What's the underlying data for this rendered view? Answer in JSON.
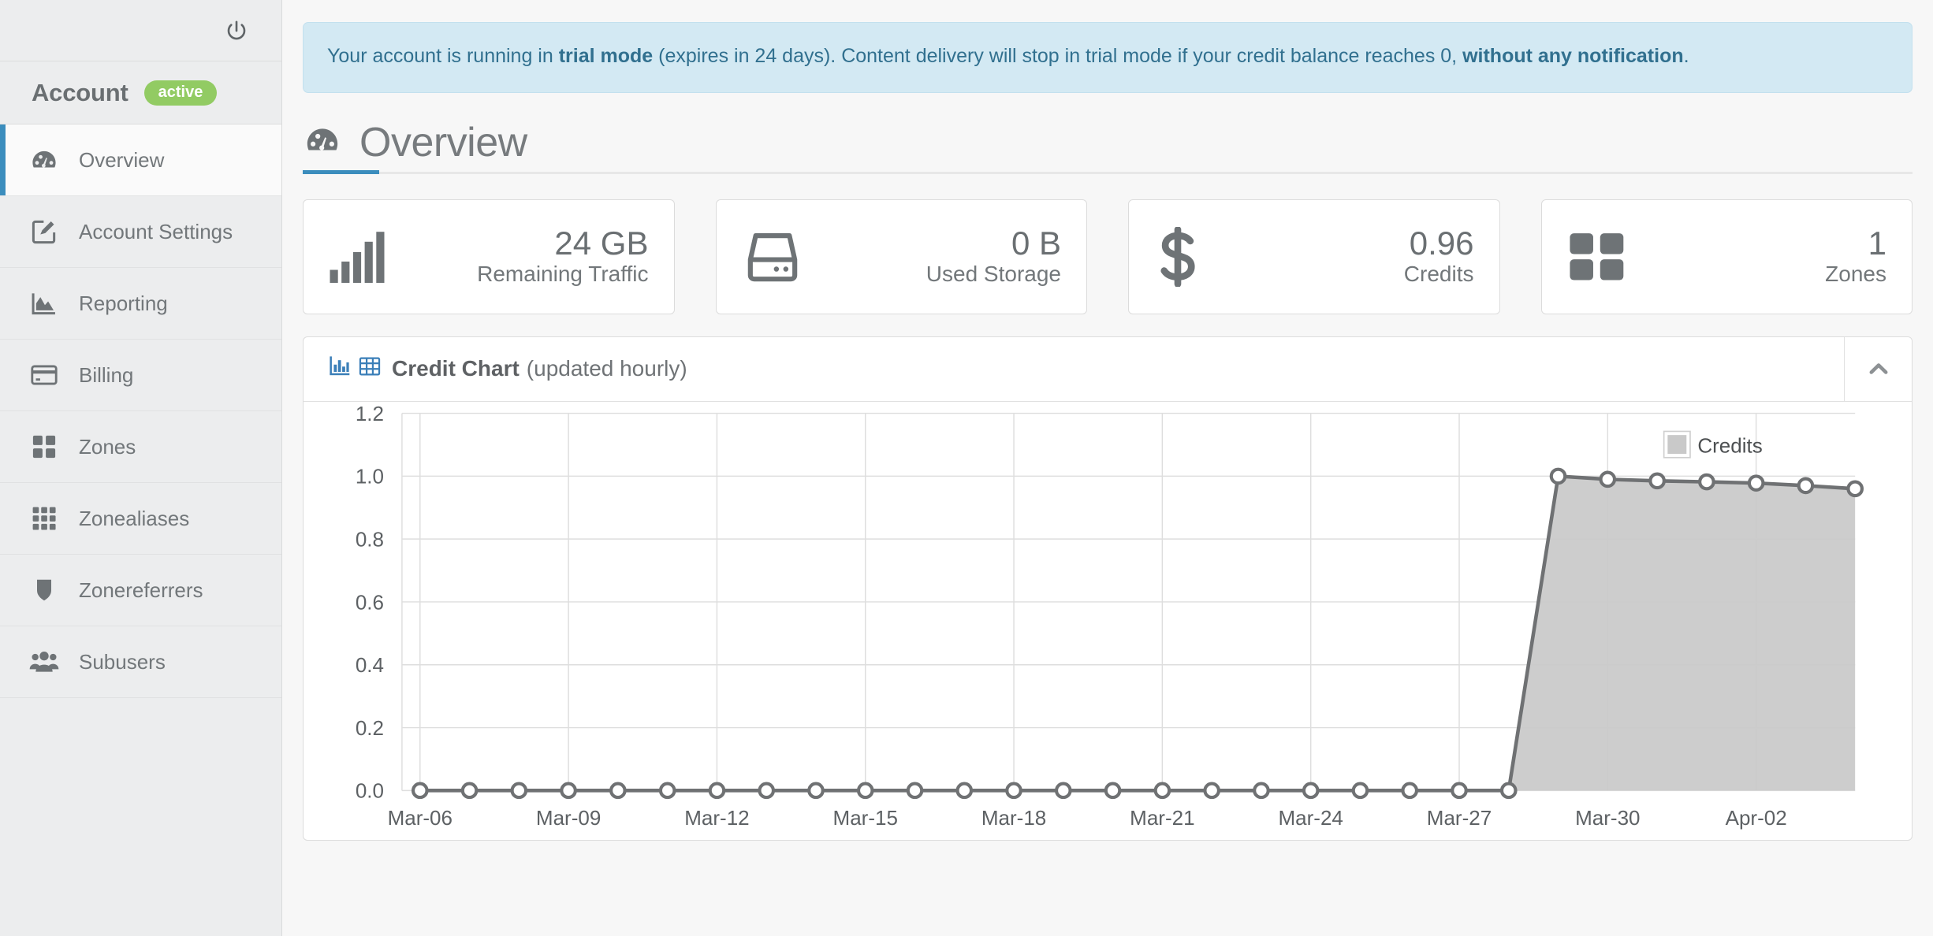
{
  "sidebar": {
    "menu_icon": "hamburger-icon",
    "power_icon": "power-icon",
    "account_title": "Account",
    "account_status": "active",
    "items": [
      {
        "label": "Overview",
        "icon": "dashboard-icon",
        "active": true
      },
      {
        "label": "Account Settings",
        "icon": "edit-square-icon",
        "active": false
      },
      {
        "label": "Reporting",
        "icon": "area-chart-icon",
        "active": false
      },
      {
        "label": "Billing",
        "icon": "credit-card-icon",
        "active": false
      },
      {
        "label": "Zones",
        "icon": "grid-2x2-icon",
        "active": false
      },
      {
        "label": "Zonealiases",
        "icon": "grid-3x3-icon",
        "active": false
      },
      {
        "label": "Zonereferrers",
        "icon": "shield-icon",
        "active": false
      },
      {
        "label": "Subusers",
        "icon": "users-icon",
        "active": false
      }
    ]
  },
  "banner": {
    "part1": "Your account is running in ",
    "bold1": "trial mode",
    "part2": " (expires in 24 days). Content delivery will stop in trial mode if your credit balance reaches 0, ",
    "bold2": "without any notification",
    "part3": "."
  },
  "page": {
    "title": "Overview",
    "title_icon": "dashboard-icon"
  },
  "stats": [
    {
      "value": "24 GB",
      "label": "Remaining Traffic",
      "icon": "signal-bars-icon"
    },
    {
      "value": "0 B",
      "label": "Used Storage",
      "icon": "hard-drive-icon"
    },
    {
      "value": "0.96",
      "label": "Credits",
      "icon": "dollar-sign-icon"
    },
    {
      "value": "1",
      "label": "Zones",
      "icon": "grid-2x2-icon"
    }
  ],
  "chart_panel": {
    "icon_bar": "bar-chart-icon",
    "icon_table": "table-icon",
    "title": "Credit Chart",
    "subtitle": "(updated hourly)",
    "collapse_icon": "chevron-up-icon"
  },
  "colors": {
    "accent": "#3b8dbd",
    "badge_green": "#92cb63",
    "banner_bg": "#d3e9f3",
    "banner_text": "#31708f",
    "series_line": "#6f7173",
    "series_fill": "#c9c9c9",
    "sidebar_bg": "#ecedee",
    "page_bg": "#f7f7f7"
  },
  "chart_data": {
    "type": "area",
    "title": "Credit Chart",
    "xlabel": "",
    "ylabel": "",
    "ylim": [
      0.0,
      1.2
    ],
    "yticks": [
      0.0,
      0.2,
      0.4,
      0.6,
      0.8,
      1.0,
      1.2
    ],
    "ytick_labels": [
      "0.0",
      "0.2",
      "0.4",
      "0.6",
      "0.8",
      "1.0",
      "1.2"
    ],
    "grid": true,
    "legend": {
      "position": "top-right",
      "entries": [
        "Credits"
      ]
    },
    "series": [
      {
        "name": "Credits",
        "line_color": "#6f7173",
        "fill_color": "#c9c9c9",
        "marker": "circle-open",
        "values": [
          0,
          0,
          0,
          0,
          0,
          0,
          0,
          0,
          0,
          0,
          0,
          0,
          0,
          0,
          0,
          0,
          0,
          0,
          0,
          0,
          0,
          0,
          0,
          1.0,
          0.99,
          0.985,
          0.982,
          0.978,
          0.97,
          0.96
        ]
      }
    ],
    "x": [
      "Mar-06",
      "Mar-07",
      "Mar-08",
      "Mar-09",
      "Mar-10",
      "Mar-11",
      "Mar-12",
      "Mar-13",
      "Mar-14",
      "Mar-15",
      "Mar-16",
      "Mar-17",
      "Mar-18",
      "Mar-19",
      "Mar-20",
      "Mar-21",
      "Mar-22",
      "Mar-23",
      "Mar-24",
      "Mar-25",
      "Mar-26",
      "Mar-27",
      "Mar-28",
      "Mar-29",
      "Mar-30",
      "Mar-31",
      "Apr-01",
      "Apr-02",
      "Apr-03",
      "Apr-04"
    ],
    "xtick_labels": [
      "Mar-06",
      "Mar-09",
      "Mar-12",
      "Mar-15",
      "Mar-18",
      "Mar-21",
      "Mar-24",
      "Mar-27",
      "Mar-30",
      "Apr-02"
    ],
    "xtick_indices": [
      0,
      3,
      6,
      9,
      12,
      15,
      18,
      21,
      24,
      27
    ]
  }
}
